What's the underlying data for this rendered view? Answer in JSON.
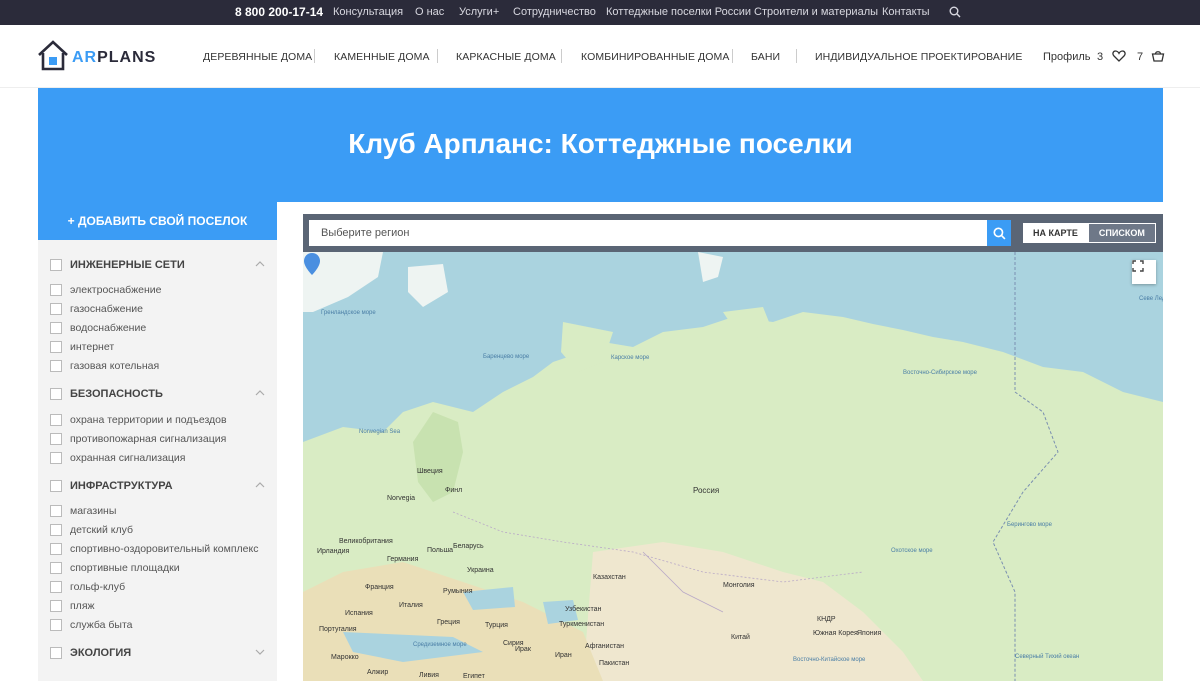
{
  "topbar": {
    "phone": "8 800 200-17-14",
    "links": [
      "Консультация",
      "О нас",
      "Услуги+",
      "Сотрудничество",
      "Коттеджные поселки России",
      "Строители и материалы",
      "Контакты"
    ],
    "search_icon": "search-icon"
  },
  "header": {
    "logo_text_accent": "AR",
    "logo_text_rest": "PLANS",
    "nav": [
      "ДЕРЕВЯННЫЕ ДОМА",
      "КАМЕННЫЕ ДОМА",
      "КАРКАСНЫЕ ДОМА",
      "КОМБИНИРОВАННЫЕ ДОМА",
      "БАНИ",
      "ИНДИВИДУАЛЬНОЕ ПРОЕКТИРОВАНИЕ"
    ],
    "profile": "Профиль",
    "favorites_count": "3",
    "cart_count": "7",
    "icons": [
      "heart-icon",
      "basket-icon"
    ]
  },
  "hero": {
    "title": "Клуб Арпланс: Коттеджные поселки"
  },
  "sidebar": {
    "add_button": "+ ДОБАВИТЬ СВОЙ ПОСЕЛОК",
    "groups": [
      {
        "title": "ИНЖЕНЕРНЫЕ СЕТИ",
        "expanded": true,
        "items": [
          "электроснабжение",
          "газоснабжение",
          "водоснабжение",
          "интернет",
          "газовая котельная"
        ]
      },
      {
        "title": "БЕЗОПАСНОСТЬ",
        "expanded": true,
        "items": [
          "охрана территории и подъездов",
          "противопожарная сигнализация",
          "охранная сигнализация"
        ]
      },
      {
        "title": "ИНФРАСТРУКТУРА",
        "expanded": true,
        "items": [
          "магазины",
          "детский клуб",
          "спортивно-оздоровительный комплекс",
          "спортивные площадки",
          "гольф-клуб",
          "пляж",
          "служба быта"
        ]
      },
      {
        "title": "ЭКОЛОГИЯ",
        "expanded": false,
        "items": []
      }
    ]
  },
  "map_panel": {
    "region_placeholder": "Выберите регион",
    "view_map": "НА КАРТЕ",
    "view_list": "СПИСКОМ",
    "labels": {
      "russia": "Россия",
      "kazakhstan": "Казахстан",
      "mongolia": "Монголия",
      "china": "Китай",
      "uzbekistan": "Узбекистан",
      "turkmenistan": "Туркменистан",
      "afghanistan": "Афганистан",
      "pakistan": "Пакистан",
      "iran": "Иран",
      "iraq": "Ирак",
      "turkey": "Турция",
      "greece": "Греция",
      "italy": "Италия",
      "spain": "Испания",
      "portugal": "Португалия",
      "france": "Франция",
      "germany": "Германия",
      "poland": "Польша",
      "belarus": "Беларусь",
      "ukraine": "Украина",
      "romania": "Румыния",
      "uk": "Великобритания",
      "ireland": "Ирландия",
      "norway": "Norvegia",
      "sweden": "Швеция",
      "finland": "Финл",
      "morocco": "Марокко",
      "algeria": "Алжир",
      "libya": "Ливия",
      "egypt": "Египет",
      "syria": "Сирия",
      "japan": "Япония",
      "south_korea": "Южная Корея",
      "north_korea": "КНДР"
    },
    "sea_labels": {
      "greenland_sea": "Гренландское море",
      "barents_sea": "Баренцево море",
      "kara_sea": "Карское море",
      "east_siberian_sea": "Восточно-Сибирское море",
      "norwegian_sea": "Norwegian Sea",
      "bering_sea": "Берингово море",
      "okhotsk_sea": "Охотское море",
      "mediterranean_sea": "Средиземное море",
      "east_china_sea": "Восточно-Китайское море",
      "north_pacific": "Северный Тихий океан",
      "arctic_north": "Севе Ледо ок"
    }
  }
}
